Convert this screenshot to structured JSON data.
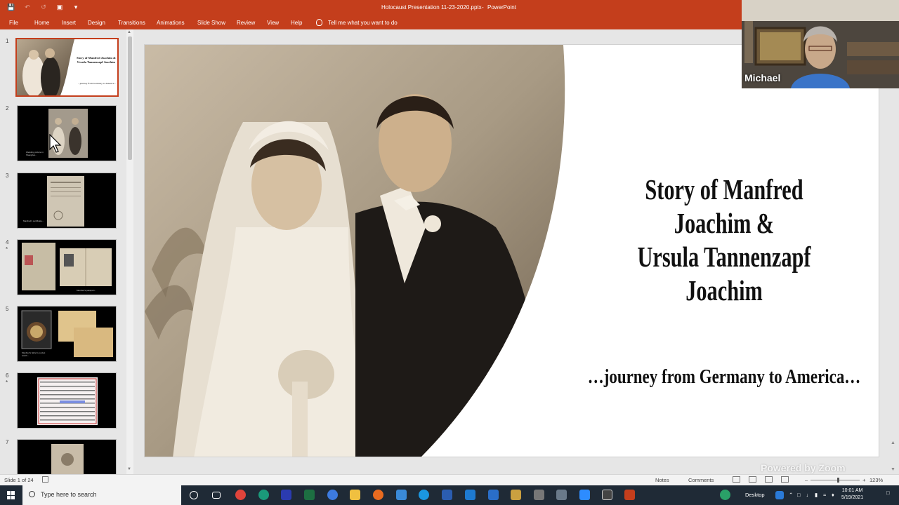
{
  "titlebar": {
    "document_title": "Holocaust Presentation 11-23-2020.pptx",
    "separator": "-",
    "app_name": "PowerPoint",
    "qat_icons": [
      "save-icon",
      "undo-icon",
      "redo-icon",
      "start-from-beginning-icon",
      "customize-qat-icon"
    ]
  },
  "menubar": {
    "tabs": [
      "File",
      "Home",
      "Insert",
      "Design",
      "Transitions",
      "Animations",
      "Slide Show",
      "Review",
      "View",
      "Help"
    ],
    "tell_me": "Tell me what you want to do"
  },
  "thumbnails": [
    {
      "number": "1",
      "star": "",
      "title_text": "Story of Manfred Joachim & Ursula Tannenzapf Joachim",
      "sub_text": "...journey from Germany to America...",
      "active": true
    },
    {
      "number": "2",
      "star": "",
      "caption": "Wedding picture in Shanghai..."
    },
    {
      "number": "3",
      "star": "",
      "caption": "Manfred's certificate..."
    },
    {
      "number": "4",
      "star": "*",
      "caption": "Manfred's passport..."
    },
    {
      "number": "5",
      "star": "",
      "caption": "Manfred's father's pocket watch..."
    },
    {
      "number": "6",
      "star": "*",
      "caption": ""
    },
    {
      "number": "7",
      "star": "",
      "caption": ""
    }
  ],
  "slide": {
    "title_line1": "Story of Manfred Joachim &",
    "title_line2": "Ursula Tannenzapf Joachim",
    "subtitle": "…journey from Germany to America…"
  },
  "zoom": {
    "participant_name": "Michael",
    "watermark": "Powered by Zoom"
  },
  "statusbar": {
    "slide_count": "Slide 1 of 24",
    "notes_label": "Notes",
    "comments_label": "Comments",
    "zoom_level": "123%",
    "zoom_fraction": 0.57
  },
  "taskbar": {
    "search_placeholder": "Type here to search",
    "desktop_label": "Desktop",
    "time": "10:01 AM",
    "date": "5/19/2021",
    "apps": [
      "cortana-icon",
      "task-view-icon",
      "chrome-icon",
      "edge-icon",
      "teams-icon",
      "excel-icon",
      "vpn-icon",
      "file-explorer-icon",
      "firefox-icon",
      "skype-icon",
      "word-icon",
      "mail-icon",
      "store-icon",
      "usb-icon",
      "camera-icon",
      "zoom-icon",
      "snip-icon",
      "powerpoint-icon"
    ]
  },
  "colors": {
    "accent": "#c43e1c",
    "taskbar": "#1f2a36"
  }
}
